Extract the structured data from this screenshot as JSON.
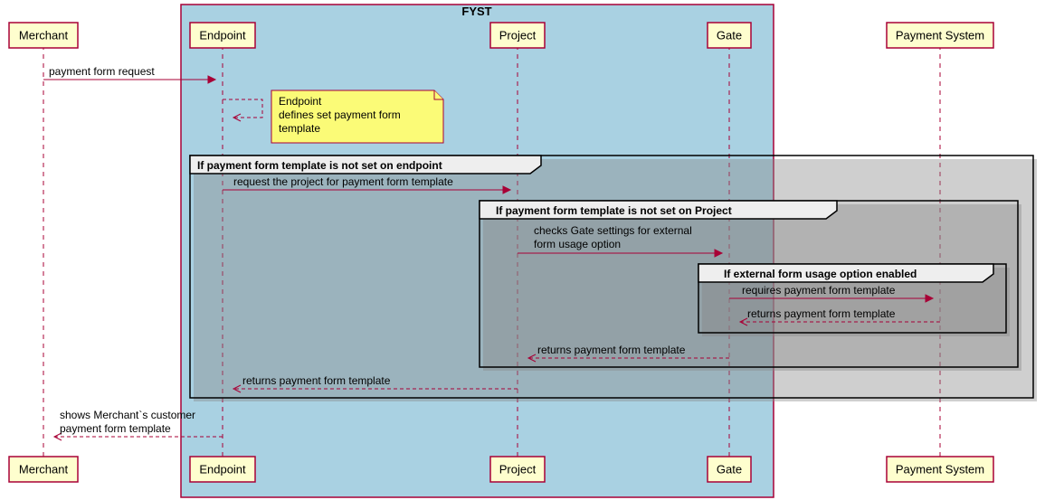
{
  "groupTitle": "FYST",
  "participants": {
    "merchant": "Merchant",
    "endpoint": "Endpoint",
    "project": "Project",
    "gate": "Gate",
    "paymentSystem": "Payment System"
  },
  "messages": {
    "m1": "payment form request",
    "note1_l1": "Endpoint",
    "note1_l2": "defines set payment form",
    "note1_l3": "template",
    "alt1_title": "If payment form template is not set on endpoint",
    "m2": "request the project for payment form template",
    "alt2_title": "If payment form template is not set on Project",
    "m3_l1": "checks Gate settings for external",
    "m3_l2": "form usage option",
    "alt3_title": "If external form usage option enabled",
    "m4": "requires payment form template",
    "m5": "returns payment form template",
    "m6": "returns payment form template",
    "m7": "returns payment form template",
    "m8_l1": "shows Merchant`s customer",
    "m8_l2": "payment form template"
  },
  "chart_data": {
    "type": "sequence_diagram",
    "group": {
      "name": "FYST",
      "participants": [
        "Endpoint",
        "Project",
        "Gate"
      ]
    },
    "participants": [
      "Merchant",
      "Endpoint",
      "Project",
      "Gate",
      "Payment System"
    ],
    "sequence": [
      {
        "from": "Merchant",
        "to": "Endpoint",
        "label": "payment form request",
        "type": "solid"
      },
      {
        "kind": "note",
        "on": "Endpoint",
        "text": "Endpoint defines set payment form template",
        "self_return": true
      },
      {
        "kind": "alt",
        "title": "If payment form template is not set on endpoint",
        "body": [
          {
            "from": "Endpoint",
            "to": "Project",
            "label": "request the project for payment form template",
            "type": "solid"
          },
          {
            "kind": "alt",
            "title": "If payment form template is not set on Project",
            "body": [
              {
                "from": "Project",
                "to": "Gate",
                "label": "checks Gate settings for external form usage option",
                "type": "solid"
              },
              {
                "kind": "alt",
                "title": "If external form usage option enabled",
                "body": [
                  {
                    "from": "Gate",
                    "to": "Payment System",
                    "label": "requires payment form template",
                    "type": "solid"
                  },
                  {
                    "from": "Payment System",
                    "to": "Gate",
                    "label": "returns payment form template",
                    "type": "dashed"
                  }
                ]
              },
              {
                "from": "Gate",
                "to": "Project",
                "label": "returns payment form template",
                "type": "dashed"
              }
            ]
          },
          {
            "from": "Project",
            "to": "Endpoint",
            "label": "returns payment form template",
            "type": "dashed"
          }
        ]
      },
      {
        "from": "Endpoint",
        "to": "Merchant",
        "label": "shows Merchant`s customer payment form template",
        "type": "dashed"
      }
    ]
  }
}
